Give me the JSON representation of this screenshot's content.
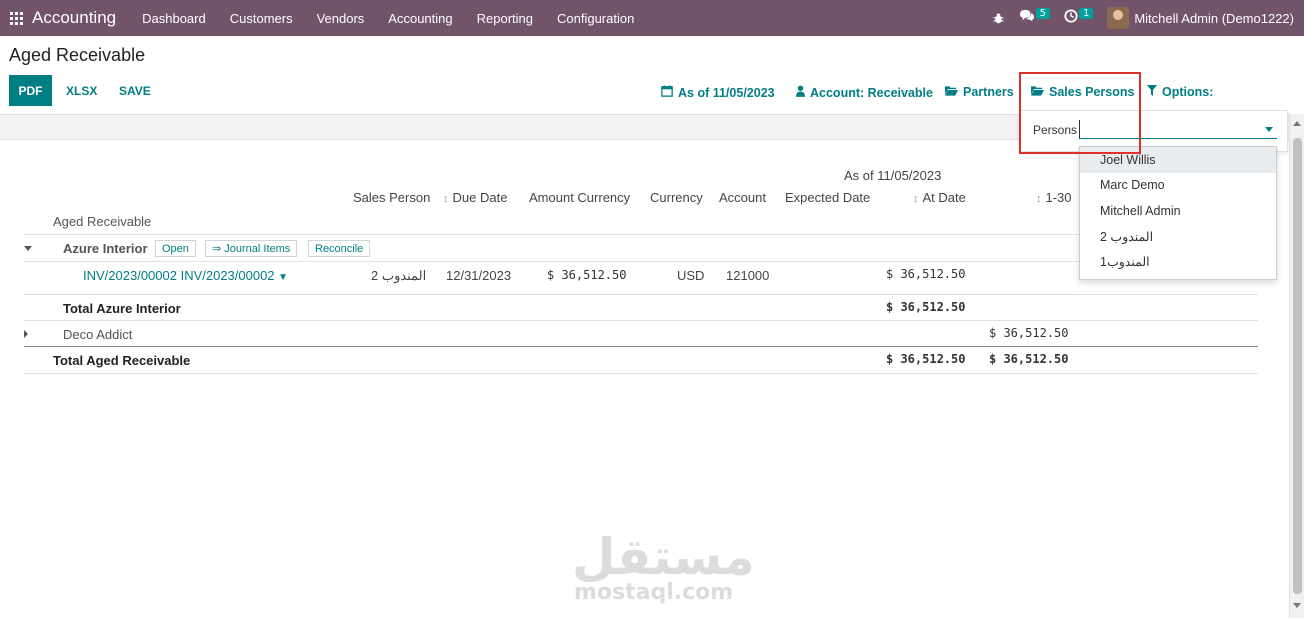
{
  "navbar": {
    "brand": "Accounting",
    "menu": [
      "Dashboard",
      "Customers",
      "Vendors",
      "Accounting",
      "Reporting",
      "Configuration"
    ],
    "messages_count": "5",
    "activities_count": "1",
    "user": "Mitchell Admin (Demo1222)",
    "color": "#71546a"
  },
  "page": {
    "title": "Aged Receivable",
    "buttons": {
      "pdf": "PDF",
      "xlsx": "XLSX",
      "save": "SAVE"
    },
    "filters": {
      "date": "As of 11/05/2023",
      "account": "Account: Receivable",
      "partners": "Partners",
      "sales_persons": "Sales Persons",
      "options": "Options:"
    },
    "accent": "#017e84"
  },
  "dropdown": {
    "label": "Persons",
    "options": [
      "Joel Willis",
      "Marc Demo",
      "Mitchell Admin",
      "المندوب 2",
      "المندوب1"
    ],
    "highlighted": "Joel Willis"
  },
  "report": {
    "period_header": "As of 11/05/2023",
    "columns": [
      "Sales Person",
      "Due Date",
      "Amount Currency",
      "Currency",
      "Account",
      "Expected Date",
      "At Date",
      "1-30"
    ],
    "section_label": "Aged Receivable",
    "partner1": {
      "name": "Azure Interior",
      "actions": [
        "Open",
        "⇒ Journal Items",
        "Reconcile"
      ],
      "line": {
        "ref": "INV/2023/00002 INV/2023/00002",
        "sales_person": "المندوب 2",
        "due_date": "12/31/2023",
        "amount_currency": "$ 36,512.50",
        "currency": "USD",
        "account": "121000",
        "at_date": "$ 36,512.50"
      },
      "total_label": "Total Azure Interior",
      "total_at_date": "$ 36,512.50"
    },
    "partner2": {
      "name": "Deco Addict",
      "p1_30": "$ 36,512.50"
    },
    "grand_total": {
      "label": "Total Aged Receivable",
      "at_date": "$ 36,512.50",
      "p1_30": "$ 36,512.50"
    }
  },
  "watermark": {
    "arabic": "مستقل",
    "latin": "mostaql.com"
  }
}
